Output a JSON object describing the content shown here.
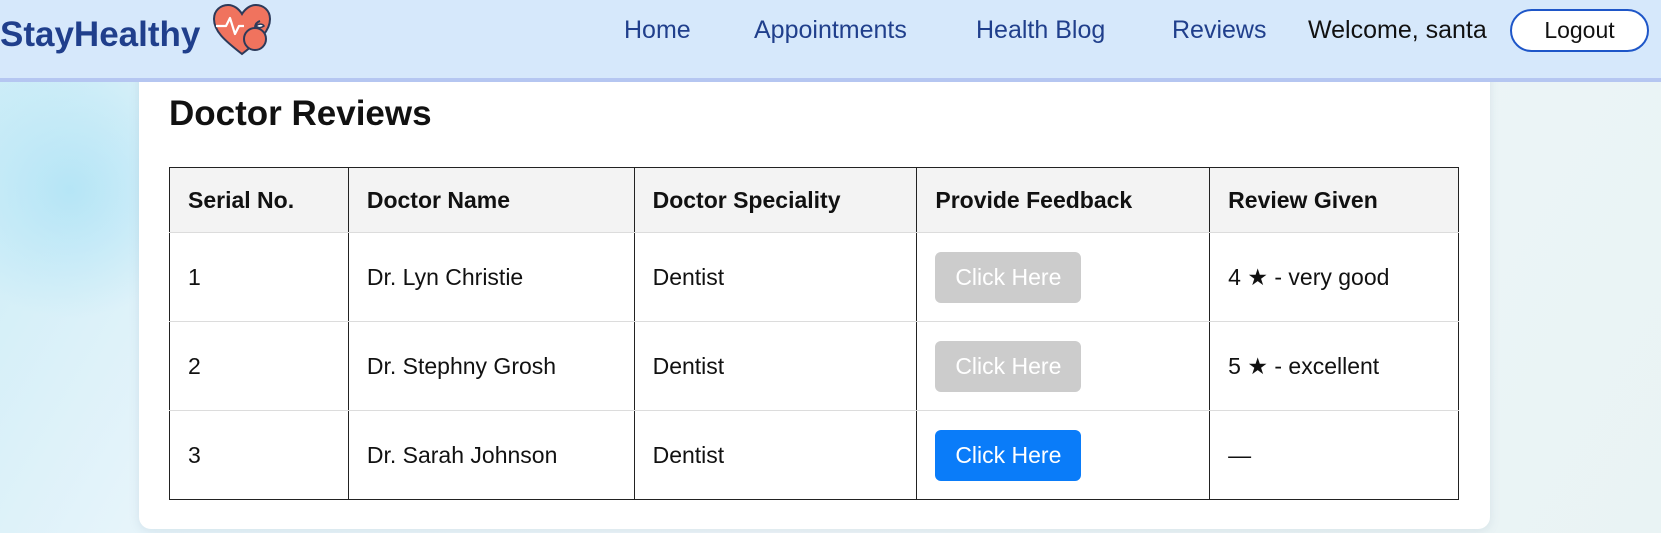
{
  "header": {
    "brand": "StayHealthy",
    "logo_icon": "heart-pulse-apple-icon",
    "nav": {
      "home": "Home",
      "appointments": "Appointments",
      "health_blog": "Health Blog",
      "reviews": "Reviews"
    },
    "welcome": "Welcome, santa",
    "logout": "Logout"
  },
  "main": {
    "title": "Doctor Reviews",
    "table": {
      "headers": [
        "Serial No.",
        "Doctor Name",
        "Doctor Speciality",
        "Provide Feedback",
        "Review Given"
      ],
      "rows": [
        {
          "serial": "1",
          "name": "Dr. Lyn Christie",
          "speciality": "Dentist",
          "feedback": "Click Here",
          "feedback_enabled": false,
          "review": "4 ★ - very good"
        },
        {
          "serial": "2",
          "name": "Dr. Stephny Grosh",
          "speciality": "Dentist",
          "feedback": "Click Here",
          "feedback_enabled": false,
          "review": "5 ★ - excellent"
        },
        {
          "serial": "3",
          "name": "Dr. Sarah Johnson",
          "speciality": "Dentist",
          "feedback": "Click Here",
          "feedback_enabled": true,
          "review": "—"
        }
      ]
    }
  },
  "colors": {
    "brand": "#203f8c",
    "header_bg": "#d6e8fb",
    "button_active": "#0a7cf9",
    "button_disabled": "#cccccc"
  }
}
